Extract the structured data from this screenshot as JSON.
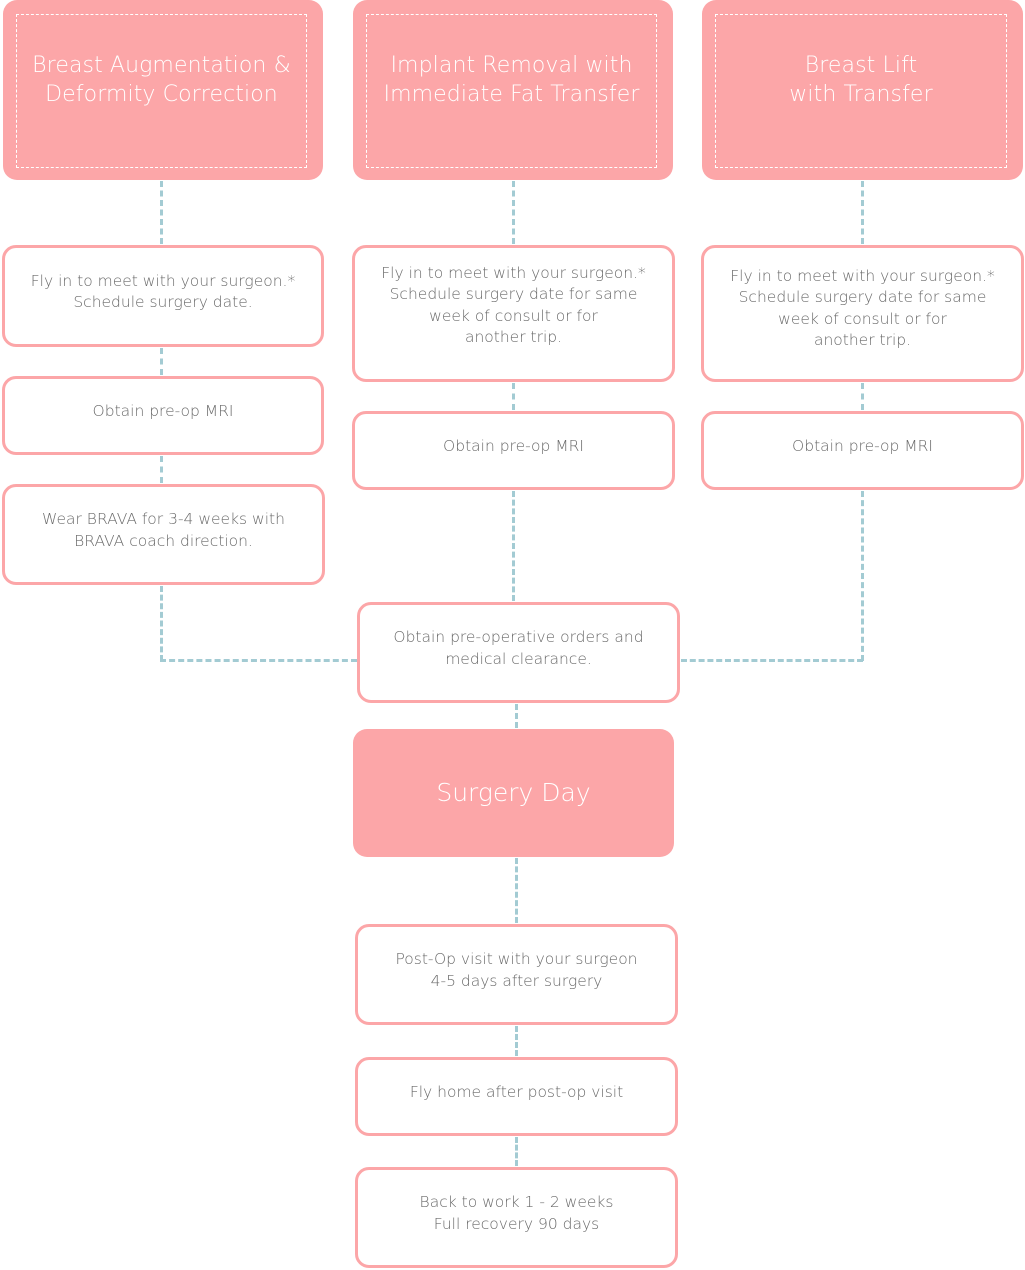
{
  "colors": {
    "accent_pink": "#fca6a8",
    "connector_blue": "#a3cbd3",
    "text_gray": "#6a6a6a",
    "text_white": "#ffffff"
  },
  "columns": [
    {
      "title": "Breast  Augmentation &\nDeformity Correction",
      "steps": [
        "Fly in to meet with your surgeon.*\nSchedule surgery date.",
        "Obtain pre-op MRI",
        "Wear BRAVA for 3-4 weeks with\nBRAVA coach direction."
      ]
    },
    {
      "title": "Implant Removal with\nImmediate Fat Transfer",
      "steps": [
        "Fly in to meet with your surgeon.*\nSchedule surgery date for same\nweek of consult or for\nanother trip.",
        "Obtain pre-op MRI"
      ]
    },
    {
      "title": "Breast Lift\nwith Transfer",
      "steps": [
        "Fly in to meet with your surgeon.*\nSchedule surgery date for same\nweek of consult or for\nanother trip.",
        "Obtain pre-op MRI"
      ]
    }
  ],
  "merge_step": "Obtain pre-operative orders and\nmedical clearance.",
  "surgery_day": "Surgery Day",
  "post_steps": [
    "Post-Op visit with your surgeon\n4-5 days after surgery",
    "Fly home after post-op visit",
    "Back to work 1 - 2 weeks\nFull recovery 90 days"
  ]
}
